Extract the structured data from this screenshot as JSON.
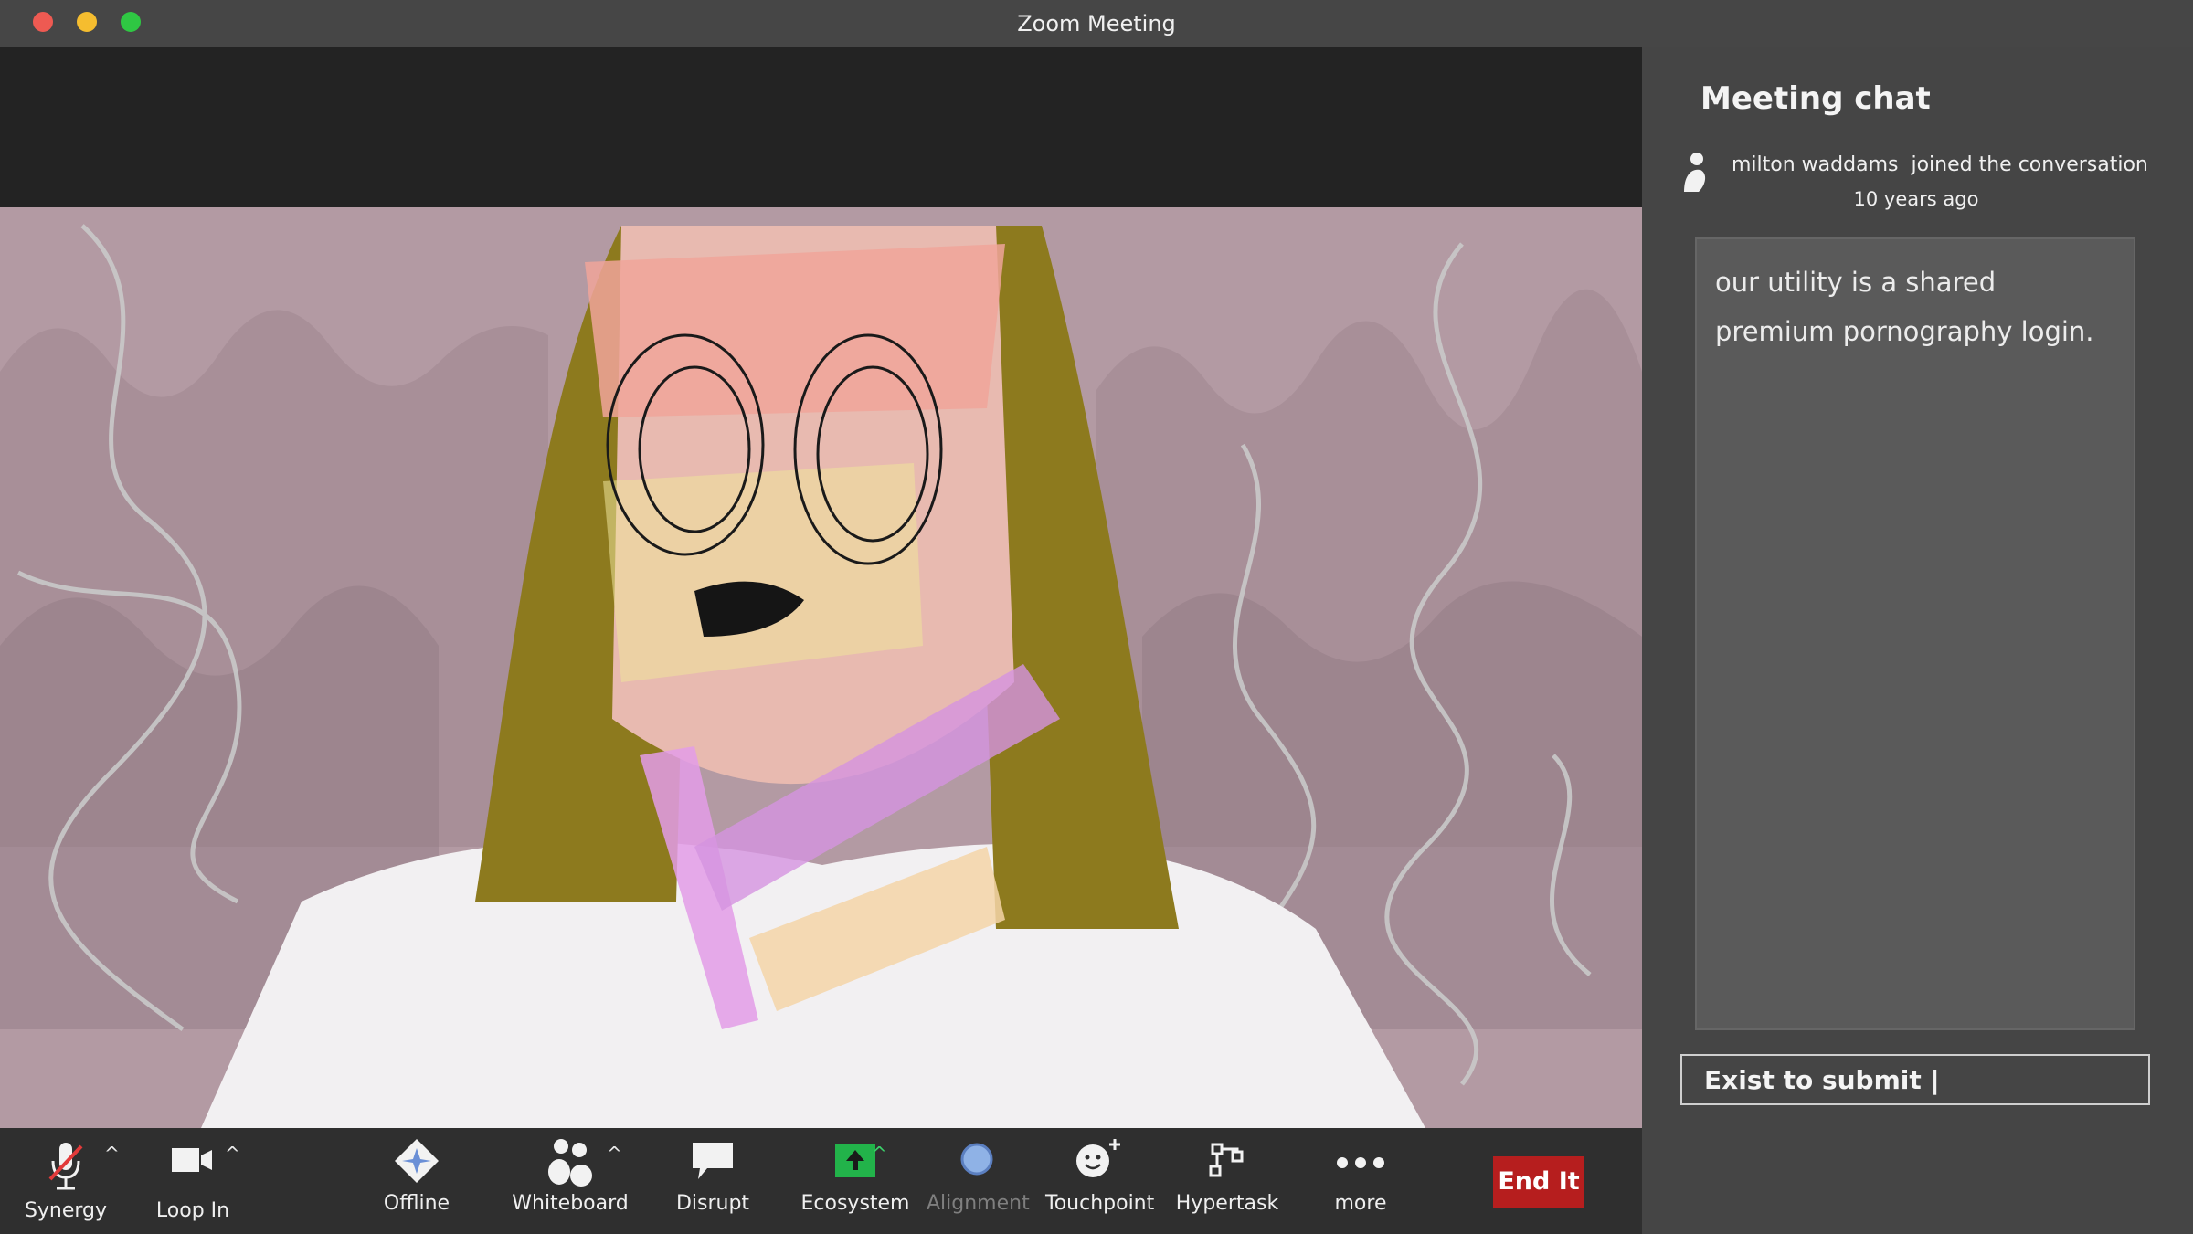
{
  "window": {
    "title": "Zoom Meeting"
  },
  "chat": {
    "title": "Meeting chat",
    "join_user": "milton waddams",
    "join_action": "joined the conversation",
    "join_time": "10 years ago",
    "message": "our utility is a shared premium pornography login.",
    "input_value": "Exist to submit |"
  },
  "toolbar": {
    "synergy": "Synergy",
    "loop_in": "Loop In",
    "offline": "Offline",
    "whiteboard": "Whiteboard",
    "disrupt": "Disrupt",
    "ecosystem": "Ecosystem",
    "alignment": "Alignment",
    "touchpoint": "Touchpoint",
    "hypertask": "Hypertask",
    "more": "more",
    "end": "End It",
    "caret": "^"
  },
  "icons": {
    "mic": "microphone-muted-icon",
    "camera": "video-camera-icon",
    "offline": "diamond-star-icon",
    "whiteboard": "people-icon",
    "disrupt": "speech-bubble-icon",
    "ecosystem": "share-up-arrow-icon",
    "alignment": "circle-icon",
    "touchpoint": "smiley-plus-icon",
    "hypertask": "workflow-icon",
    "more": "ellipsis-icon"
  },
  "colors": {
    "end_button": "#b61e1e",
    "ecosystem_green": "#22b34a",
    "alignment_blue": "#8fb2e6"
  }
}
